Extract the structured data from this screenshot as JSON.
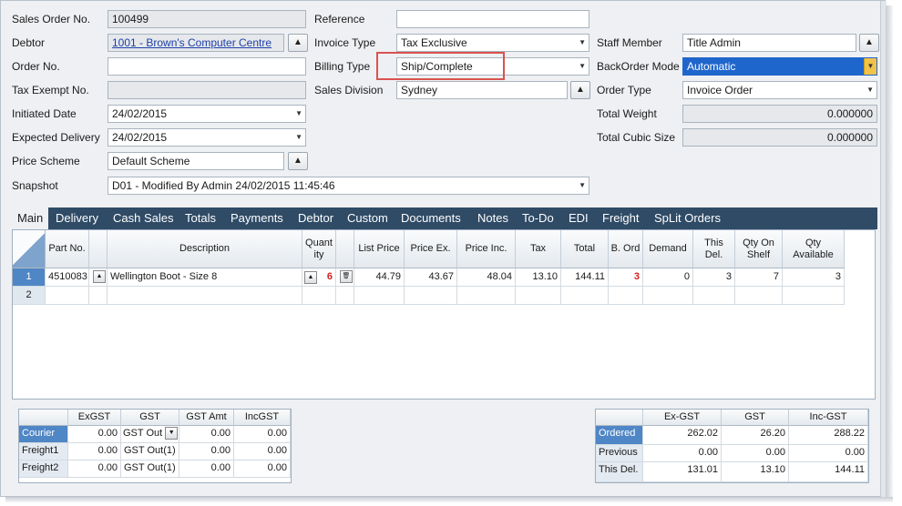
{
  "form": {
    "sales_order_no": {
      "label": "Sales Order No.",
      "value": "100499"
    },
    "debtor": {
      "label": "Debtor",
      "value": "1001 - Brown's Computer Centre"
    },
    "order_no": {
      "label": "Order No.",
      "value": ""
    },
    "tax_exempt_no": {
      "label": "Tax Exempt No.",
      "value": ""
    },
    "initiated_date": {
      "label": "Initiated Date",
      "value": "24/02/2015"
    },
    "expected_delivery": {
      "label": "Expected Delivery",
      "value": "24/02/2015"
    },
    "price_scheme": {
      "label": "Price Scheme",
      "value": "Default Scheme"
    },
    "snapshot": {
      "label": "Snapshot",
      "value": "D01 - Modified By Admin 24/02/2015 11:45:46"
    },
    "reference": {
      "label": "Reference",
      "value": ""
    },
    "invoice_type": {
      "label": "Invoice Type",
      "value": "Tax Exclusive"
    },
    "billing_type": {
      "label": "Billing Type",
      "value": "Ship/Complete"
    },
    "sales_division": {
      "label": "Sales Division",
      "value": "Sydney"
    },
    "staff_member": {
      "label": "Staff Member",
      "value": "Title Admin"
    },
    "backorder_mode": {
      "label": "BackOrder Mode",
      "value": "Automatic"
    },
    "order_type": {
      "label": "Order Type",
      "value": "Invoice Order"
    },
    "total_weight": {
      "label": "Total Weight",
      "value": "0.000000"
    },
    "total_cubic_size": {
      "label": "Total Cubic Size",
      "value": "0.000000"
    }
  },
  "icons": {
    "up": "▲",
    "down": "▼",
    "delete": "🗑"
  },
  "colors": {
    "tab_bar": "#2f4b66",
    "highlight": "#d9534f",
    "selected": "#1f66cc",
    "red_value": "#d32020"
  },
  "tabs": [
    {
      "label": "Main"
    },
    {
      "label": "Delivery"
    },
    {
      "label": "Cash Sales"
    },
    {
      "label": "Totals"
    },
    {
      "label": "Payments"
    },
    {
      "label": "Debtor"
    },
    {
      "label": "Custom"
    },
    {
      "label": "Documents"
    },
    {
      "label": "Notes"
    },
    {
      "label": "To-Do"
    },
    {
      "label": "EDI"
    },
    {
      "label": "Freight"
    },
    {
      "label": "SpLit Orders"
    }
  ],
  "lines": {
    "headers": [
      "Part No.",
      "Description",
      "Quant ity",
      "List Price",
      "Price Ex.",
      "Price Inc.",
      "Tax",
      "Total",
      "B. Ord",
      "Demand",
      "This Del.",
      "Qty On Shelf",
      "Qty Available"
    ],
    "rows": [
      {
        "row": "1",
        "part_no": "4510083",
        "description": "Wellington Boot - Size 8",
        "quantity": "6",
        "list_price": "44.79",
        "price_ex": "43.67",
        "price_inc": "48.04",
        "tax": "13.10",
        "total": "144.11",
        "b_ord": "3",
        "demand": "0",
        "this_del": "3",
        "qty_on_shelf": "7",
        "qty_available": "3"
      },
      {
        "row": "2"
      }
    ]
  },
  "freight": {
    "headers": [
      "ExGST",
      "GST",
      "GST Amt",
      "IncGST"
    ],
    "rows": [
      {
        "name": "Courier",
        "exgst": "0.00",
        "gst": "GST Out",
        "gst_amt": "0.00",
        "incgst": "0.00"
      },
      {
        "name": "Freight1",
        "exgst": "0.00",
        "gst": "GST Out(1)",
        "gst_amt": "0.00",
        "incgst": "0.00"
      },
      {
        "name": "Freight2",
        "exgst": "0.00",
        "gst": "GST Out(1)",
        "gst_amt": "0.00",
        "incgst": "0.00"
      }
    ]
  },
  "totals": {
    "headers": [
      "Ex-GST",
      "GST",
      "Inc-GST"
    ],
    "rows": [
      {
        "name": "Ordered",
        "ex_gst": "262.02",
        "gst": "26.20",
        "inc_gst": "288.22"
      },
      {
        "name": "Previous",
        "ex_gst": "0.00",
        "gst": "0.00",
        "inc_gst": "0.00"
      },
      {
        "name": "This Del.",
        "ex_gst": "131.01",
        "gst": "13.10",
        "inc_gst": "144.11"
      }
    ]
  }
}
